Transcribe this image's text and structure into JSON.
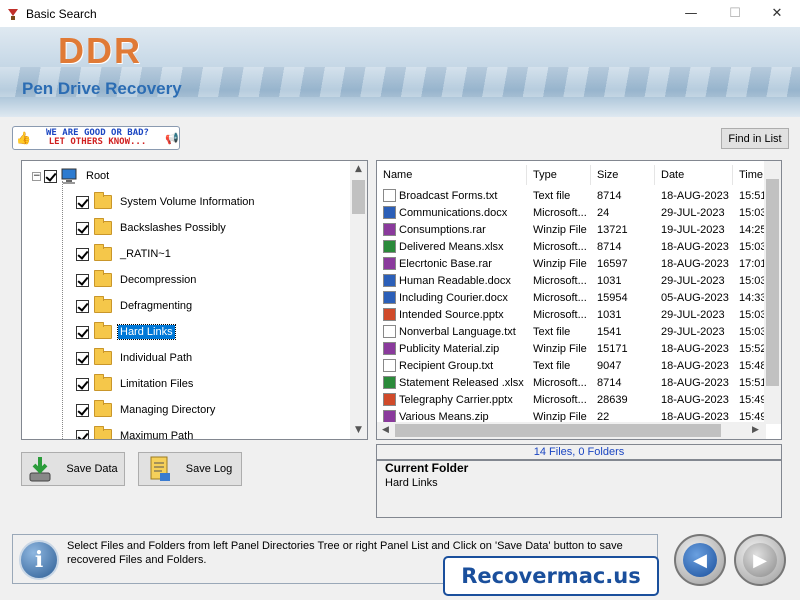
{
  "window": {
    "title": "Basic Search",
    "minimize": "—",
    "maximize": "☐",
    "close": "✕"
  },
  "banner": {
    "logo": "DDR",
    "subtitle": "Pen Drive Recovery"
  },
  "feedback": {
    "line1": "WE ARE GOOD OR BAD?",
    "line2": "LET OTHERS KNOW..."
  },
  "find_button": "Find in List",
  "tree": {
    "root": "Root",
    "items": [
      {
        "label": "System Volume Information",
        "selected": false
      },
      {
        "label": "Backslashes Possibly",
        "selected": false
      },
      {
        "label": "_RATIN~1",
        "selected": false
      },
      {
        "label": "Decompression",
        "selected": false
      },
      {
        "label": "Defragmenting",
        "selected": false
      },
      {
        "label": "Hard Links",
        "selected": true
      },
      {
        "label": "Individual Path",
        "selected": false
      },
      {
        "label": "Limitation Files",
        "selected": false
      },
      {
        "label": "Managing Directory",
        "selected": false
      },
      {
        "label": "Maximum Path",
        "selected": false
      }
    ]
  },
  "list": {
    "columns": [
      "Name",
      "Type",
      "Size",
      "Date",
      "Time"
    ],
    "rows": [
      {
        "name": "Broadcast Forms.txt",
        "type": "Text file",
        "size": "8714",
        "date": "18-AUG-2023",
        "time": "15:51",
        "icon": "txt"
      },
      {
        "name": "Communications.docx",
        "type": "Microsoft...",
        "size": "24",
        "date": "29-JUL-2023",
        "time": "15:03",
        "icon": "docx"
      },
      {
        "name": "Consumptions.rar",
        "type": "Winzip File",
        "size": "13721",
        "date": "19-JUL-2023",
        "time": "14:25",
        "icon": "zip"
      },
      {
        "name": "Delivered Means.xlsx",
        "type": "Microsoft...",
        "size": "8714",
        "date": "18-AUG-2023",
        "time": "15:03",
        "icon": "xlsx"
      },
      {
        "name": "Elecrtonic Base.rar",
        "type": "Winzip File",
        "size": "16597",
        "date": "18-AUG-2023",
        "time": "17:01",
        "icon": "zip"
      },
      {
        "name": "Human Readable.docx",
        "type": "Microsoft...",
        "size": "1031",
        "date": "29-JUL-2023",
        "time": "15:03",
        "icon": "docx"
      },
      {
        "name": "Including Courier.docx",
        "type": "Microsoft...",
        "size": "15954",
        "date": "05-AUG-2023",
        "time": "14:33",
        "icon": "docx"
      },
      {
        "name": "Intended Source.pptx",
        "type": "Microsoft...",
        "size": "1031",
        "date": "29-JUL-2023",
        "time": "15:03",
        "icon": "pptx"
      },
      {
        "name": "Nonverbal Language.txt",
        "type": "Text file",
        "size": "1541",
        "date": "29-JUL-2023",
        "time": "15:03",
        "icon": "txt"
      },
      {
        "name": "Publicity Material.zip",
        "type": "Winzip File",
        "size": "15171",
        "date": "18-AUG-2023",
        "time": "15:52",
        "icon": "zip"
      },
      {
        "name": "Recipient Group.txt",
        "type": "Text file",
        "size": "9047",
        "date": "18-AUG-2023",
        "time": "15:48",
        "icon": "txt"
      },
      {
        "name": "Statement Released .xlsx",
        "type": "Microsoft...",
        "size": "8714",
        "date": "18-AUG-2023",
        "time": "15:51",
        "icon": "xlsx"
      },
      {
        "name": "Telegraphy Carrier.pptx",
        "type": "Microsoft...",
        "size": "28639",
        "date": "18-AUG-2023",
        "time": "15:49",
        "icon": "pptx"
      },
      {
        "name": "Various Means.zip",
        "type": "Winzip File",
        "size": "22",
        "date": "18-AUG-2023",
        "time": "15:49",
        "icon": "zip"
      }
    ]
  },
  "status": "14 Files, 0 Folders",
  "current_folder": {
    "heading": "Current Folder",
    "value": "Hard Links"
  },
  "buttons": {
    "save_data": "Save Data",
    "save_log": "Save Log"
  },
  "help_text": "Select Files and Folders from left Panel Directories Tree or right Panel List and Click on 'Save Data' button to save recovered Files and Folders.",
  "watermark": "Recovermac.us",
  "colors": {
    "accent": "#0078d7",
    "logo": "#e07a36",
    "subtitle": "#2b6cb3",
    "link_blue": "#1b46c2"
  }
}
